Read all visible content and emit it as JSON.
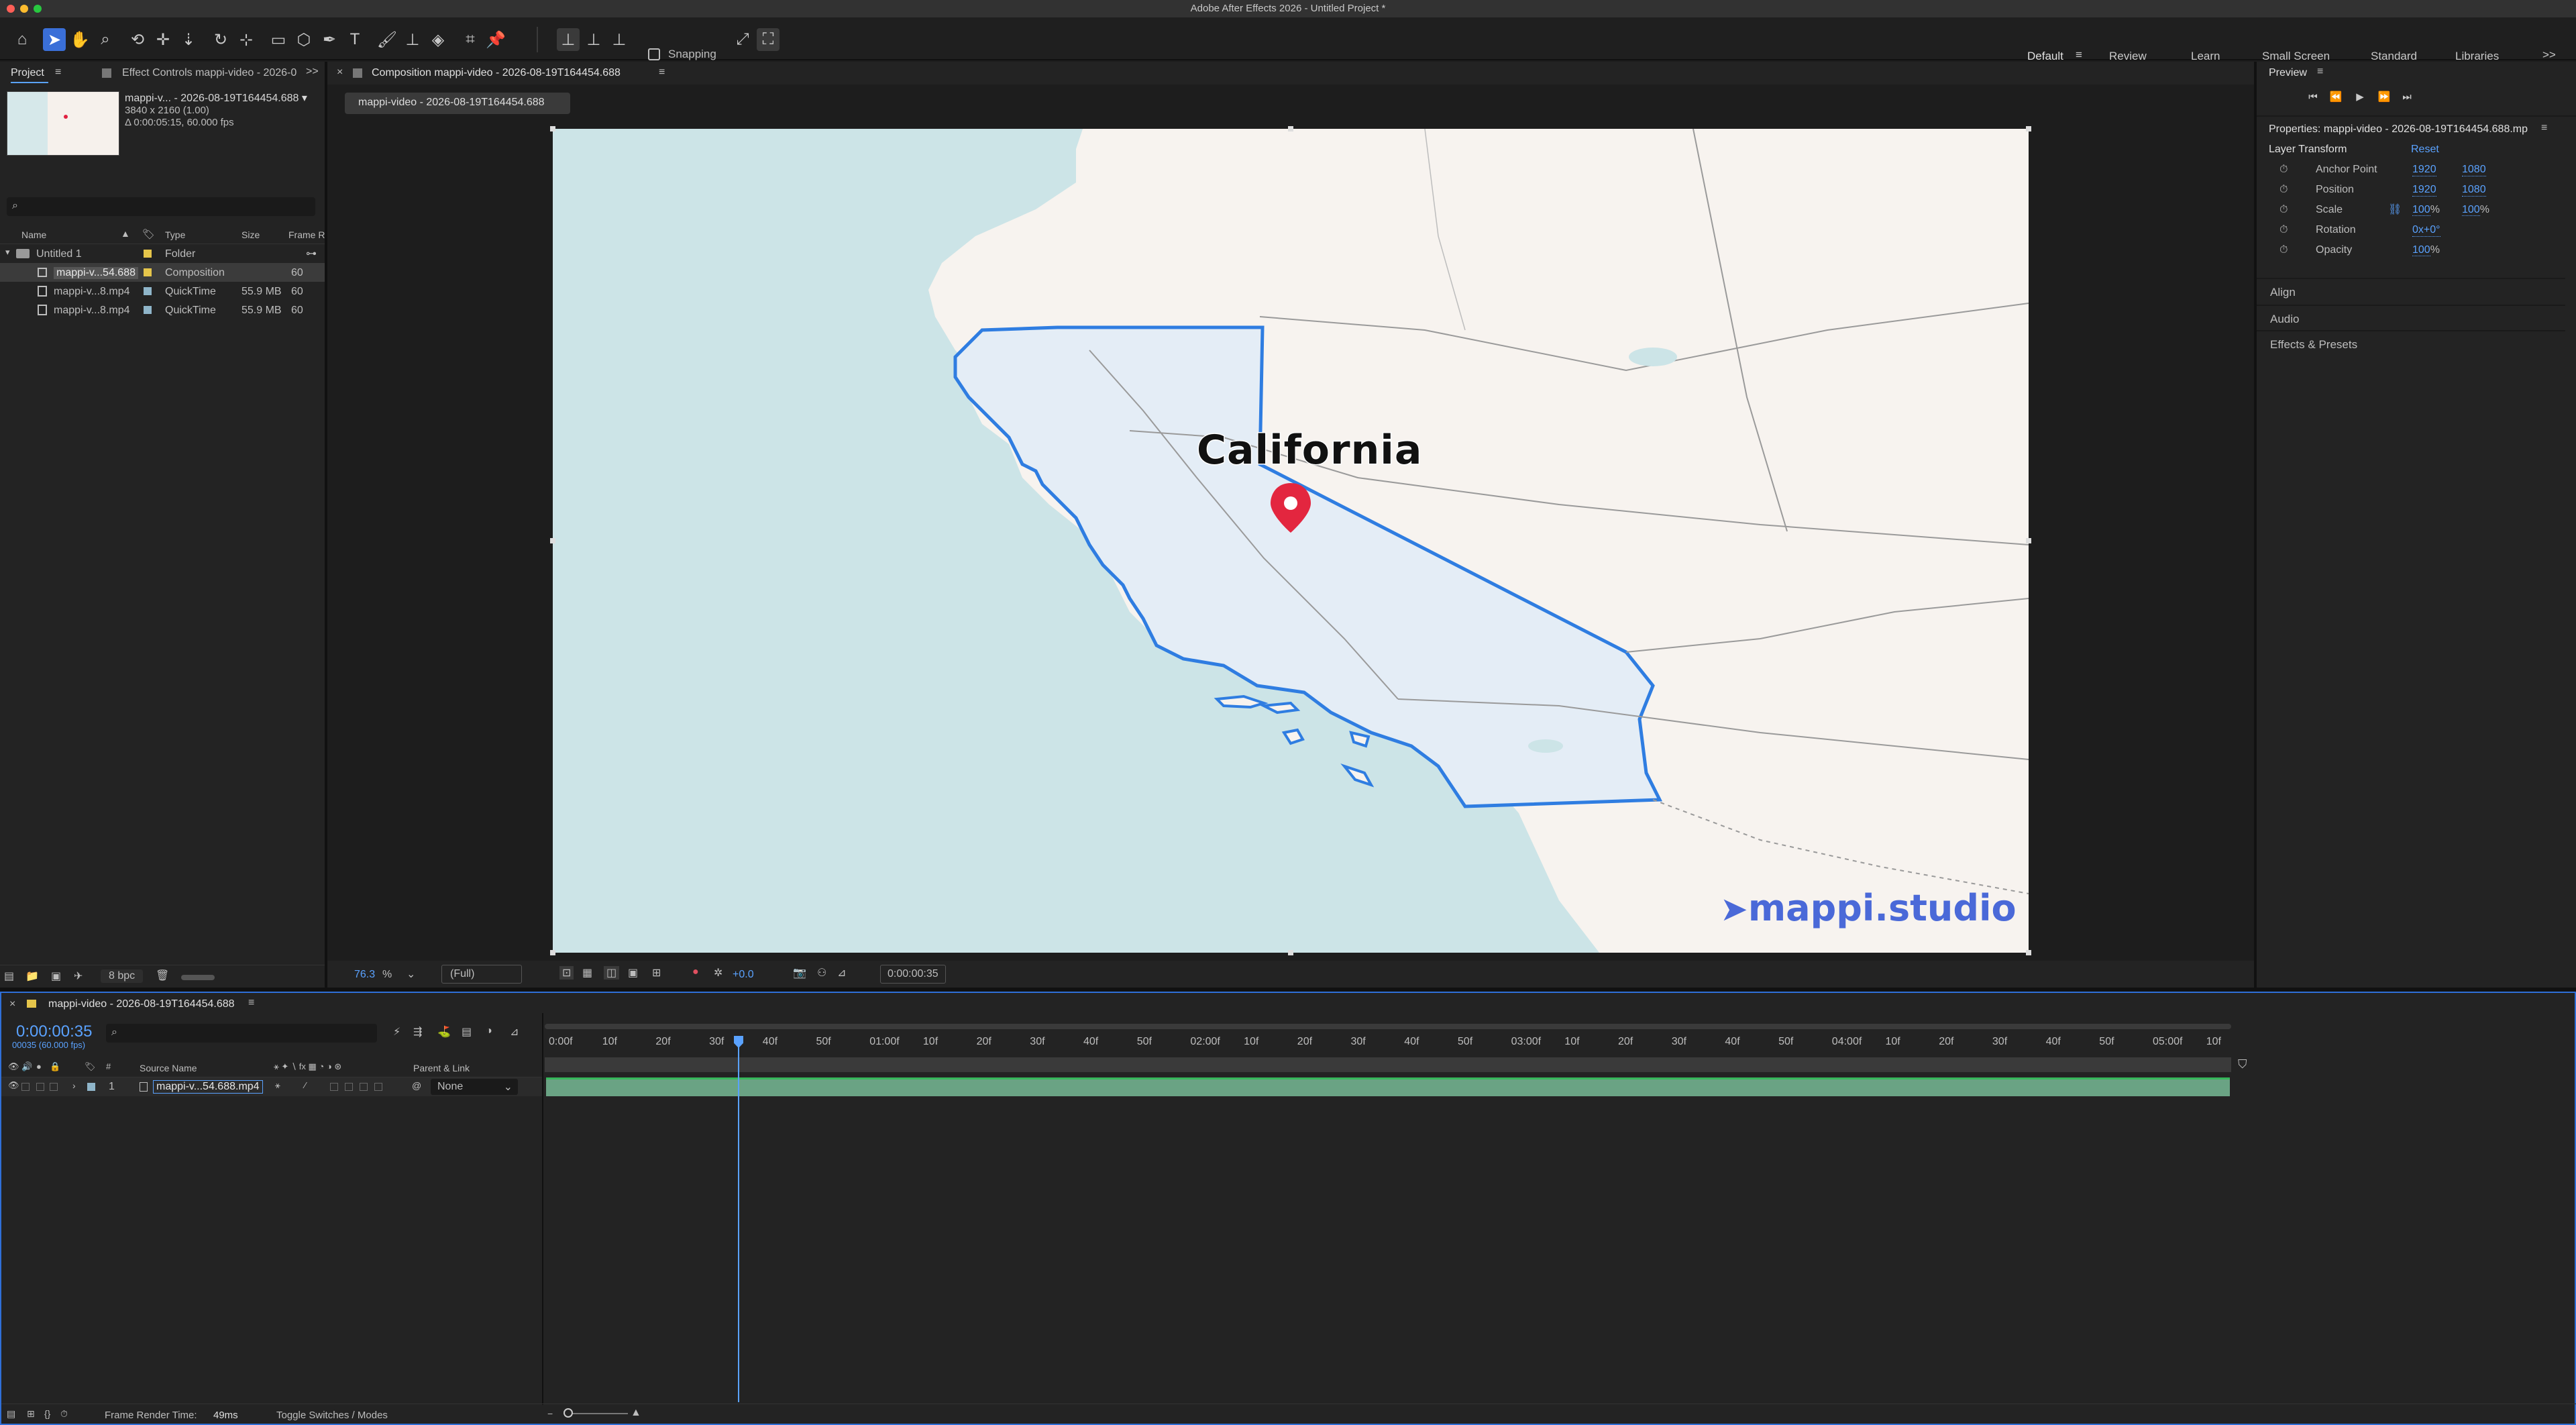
{
  "app": {
    "title": "Adobe After Effects 2026 - Untitled Project *"
  },
  "toolbar": {
    "snapping_label": "Snapping",
    "workspaces": [
      "Default",
      "Review",
      "Learn",
      "Small Screen",
      "Standard",
      "Libraries"
    ],
    "overflow": ">>"
  },
  "project_panel": {
    "tab_project": "Project",
    "tab_effects": "Effect Controls mappi-video - 2026-0",
    "overflow": ">>",
    "thumb_name": "mappi-v... - 2026-08-19T164454.688 ▾",
    "thumb_dims": "3840 x 2160 (1.00)",
    "thumb_duration": "Δ 0:00:05:15, 60.000 fps",
    "search_placeholder": "",
    "columns": [
      "Name",
      "Type",
      "Size",
      "Frame R"
    ],
    "items": [
      {
        "name": "Untitled 1",
        "type": "Folder",
        "size": "",
        "frame": "",
        "color": "#e5c54a"
      },
      {
        "name": "mappi-v...54.688",
        "type": "Composition",
        "size": "",
        "frame": "60",
        "color": "#e5c54a"
      },
      {
        "name": "mappi-v...8.mp4",
        "type": "QuickTime",
        "size": "55.9 MB",
        "frame": "60",
        "color": "#8fb5c9"
      },
      {
        "name": "mappi-v...8.mp4",
        "type": "QuickTime",
        "size": "55.9 MB",
        "frame": "60",
        "color": "#8fb5c9"
      }
    ],
    "bpc": "8 bpc"
  },
  "composition": {
    "tab_label": "Composition mappi-video - 2026-08-19T164454.688",
    "subtab_label": "mappi-video - 2026-08-19T164454.688",
    "map_label": "California",
    "watermark": "mappi.studio",
    "zoom": "76.3",
    "zoom_unit": "%",
    "resolution": "(Full)",
    "exposure": "+0.0",
    "timecode": "0:00:00:35"
  },
  "right_panel": {
    "preview_title": "Preview",
    "properties_title": "Properties: mappi-video - 2026-08-19T164454.688.mp",
    "layer_transform": "Layer Transform",
    "reset": "Reset",
    "props": [
      {
        "name": "Anchor Point",
        "v1": "1920",
        "v2": "1080"
      },
      {
        "name": "Position",
        "v1": "1920",
        "v2": "1080"
      },
      {
        "name": "Scale",
        "v1": "100",
        "v2": "100",
        "unit": "%"
      },
      {
        "name": "Rotation",
        "v1": "0x+0°",
        "v2": ""
      },
      {
        "name": "Opacity",
        "v1": "100",
        "v2": "",
        "unit": "%"
      }
    ],
    "sections": [
      "Align",
      "Audio",
      "Effects & Presets"
    ]
  },
  "timeline": {
    "tab_label": "mappi-video - 2026-08-19T164454.688",
    "timecode": "0:00:00:35",
    "fps_sub": "00035 (60.000 fps)",
    "col_source": "Source Name",
    "col_parent": "Parent & Link",
    "layer_index": "1",
    "layer_name": "mappi-v...54.688.mp4",
    "layer_parent": "None",
    "ruler": [
      "0:00f",
      "10f",
      "20f",
      "30f",
      "40f",
      "50f",
      "01:00f",
      "10f",
      "20f",
      "30f",
      "40f",
      "50f",
      "02:00f",
      "10f",
      "20f",
      "30f",
      "40f",
      "50f",
      "03:00f",
      "10f",
      "20f",
      "30f",
      "40f",
      "50f",
      "04:00f",
      "10f",
      "20f",
      "30f",
      "40f",
      "50f",
      "05:00f",
      "10f"
    ],
    "render_time_label": "Frame Render Time:",
    "render_time_value": "49ms",
    "toggle_label": "Toggle Switches / Modes"
  }
}
